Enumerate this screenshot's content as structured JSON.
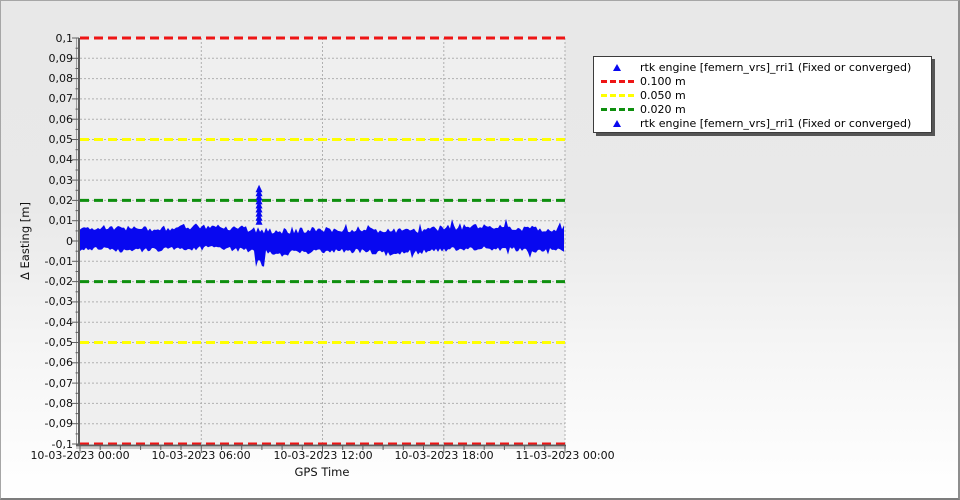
{
  "chart_data": {
    "type": "scatter",
    "title": "",
    "xlabel": "GPS Time",
    "ylabel": "Δ Easting [m]",
    "x_axis": {
      "start": "10-03-2023 00:00",
      "end": "11-03-2023 00:00",
      "span_hours": 24,
      "major_tick_hours": 6,
      "minor_tick_hours": 1,
      "tick_labels": [
        "10-03-2023 00:00",
        "10-03-2023 06:00",
        "10-03-2023 12:00",
        "10-03-2023 18:00",
        "11-03-2023 00:00"
      ]
    },
    "y_axis": {
      "min": -0.1,
      "max": 0.1,
      "major_tick_step": 0.01,
      "minor_tick_step": 0.005,
      "tick_labels": [
        "0,1",
        "0,09",
        "0,08",
        "0,07",
        "0,06",
        "0,05",
        "0,04",
        "0,03",
        "0,02",
        "0,01",
        "0",
        "-0,01",
        "-0,02",
        "-0,03",
        "-0,04",
        "-0,05",
        "-0,06",
        "-0,07",
        "-0,08",
        "-0,09",
        "-0,1"
      ]
    },
    "grid": true,
    "thresholds": [
      {
        "label": "0.100 m",
        "values": [
          0.1,
          -0.1
        ],
        "color": "#ee1515"
      },
      {
        "label": "0.050 m",
        "values": [
          0.05,
          -0.05
        ],
        "color": "#ffff00"
      },
      {
        "label": "0.020 m",
        "values": [
          0.02,
          -0.02
        ],
        "color": "#0e8f0e"
      }
    ],
    "series": [
      {
        "name": "rtk engine [femern_vrs]_rri1 (Fixed or converged)",
        "color": "#0808f0",
        "marker": "triangle",
        "noise_band": {
          "top_typical": 0.006,
          "top_max": 0.011,
          "bottom_typical": -0.0045,
          "bottom_min": -0.008,
          "mean": 0.001
        },
        "outlier_spike": {
          "time": "10-03-2023 08:50",
          "hours": 8.86,
          "max_value": 0.026,
          "min_value": -0.013
        }
      }
    ]
  },
  "legend": {
    "items": [
      {
        "marker": "triangle",
        "color": "#0808f0",
        "label": "rtk engine [femern_vrs]_rri1 (Fixed or converged)"
      },
      {
        "marker": "dash",
        "color": "#ee1515",
        "label": "0.100 m"
      },
      {
        "marker": "dash",
        "color": "#ffff00",
        "label": "0.050 m"
      },
      {
        "marker": "dash",
        "color": "#0e8f0e",
        "label": "0.020 m"
      },
      {
        "marker": "triangle",
        "color": "#0808f0",
        "label": "rtk engine [femern_vrs]_rri1 (Fixed or converged)"
      }
    ]
  },
  "style": {
    "plot_background": "#efefef",
    "grid_color": "#b0b0b0",
    "axis_color": "#5f5f5f"
  }
}
